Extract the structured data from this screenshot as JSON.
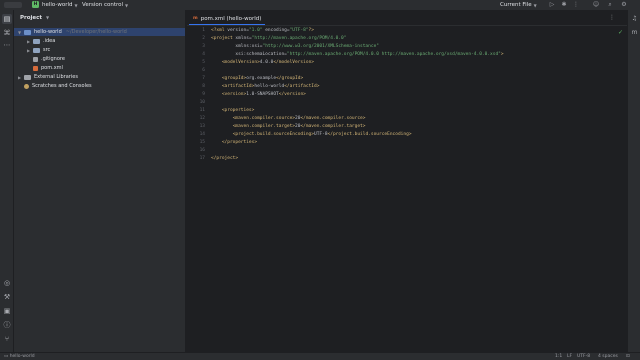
{
  "titlebar": {
    "project_initial": "H",
    "project_name": "hello-world",
    "vcs": "Version control",
    "current_file": "Current File"
  },
  "project_panel": {
    "title": "Project",
    "tree": [
      {
        "label": "hello-world",
        "path": "~/Developer/hello-world",
        "icon": "module-folder-icon",
        "expanded": true,
        "depth": 0
      },
      {
        "label": ".idea",
        "icon": "folder-icon",
        "expanded": false,
        "depth": 1
      },
      {
        "label": "src",
        "icon": "folder-icon",
        "expanded": false,
        "depth": 1
      },
      {
        "label": ".gitignore",
        "icon": "gitignore-file-icon",
        "depth": 1
      },
      {
        "label": "pom.xml",
        "icon": "maven-file-icon",
        "depth": 1
      },
      {
        "label": "External Libraries",
        "icon": "library-icon",
        "expanded": false,
        "depth": 0
      },
      {
        "label": "Scratches and Consoles",
        "icon": "scratch-icon",
        "depth": 0
      }
    ]
  },
  "editor": {
    "tab_label": "pom.xml (hello-world)",
    "lines": [
      "<?xml version=\"1.0\" encoding=\"UTF-8\"?>",
      "<project xmlns=\"http://maven.apache.org/POM/4.0.0\"",
      "         xmlns:xsi=\"http://www.w3.org/2001/XMLSchema-instance\"",
      "         xsi:schemaLocation=\"http://maven.apache.org/POM/4.0.0 http://maven.apache.org/xsd/maven-4.0.0.xsd\">",
      "    <modelVersion>4.0.0</modelVersion>",
      "",
      "    <groupId>org.example</groupId>",
      "    <artifactId>hello-world</artifactId>",
      "    <version>1.0-SNAPSHOT</version>",
      "",
      "    <properties>",
      "        <maven.compiler.source>20</maven.compiler.source>",
      "        <maven.compiler.target>20</maven.compiler.target>",
      "        <project.build.sourceEncoding>UTF-8</project.build.sourceEncoding>",
      "    </properties>",
      "",
      "</project>"
    ]
  },
  "statusbar": {
    "path": "hello-world",
    "position": "1:1",
    "line_sep": "LF",
    "encoding": "UTF-8",
    "indent": "4 spaces"
  },
  "colors": {
    "background": "#1e1f22",
    "panel": "#2b2d30",
    "accent": "#3574f0",
    "tag": "#d5b778",
    "string": "#6aab73"
  }
}
